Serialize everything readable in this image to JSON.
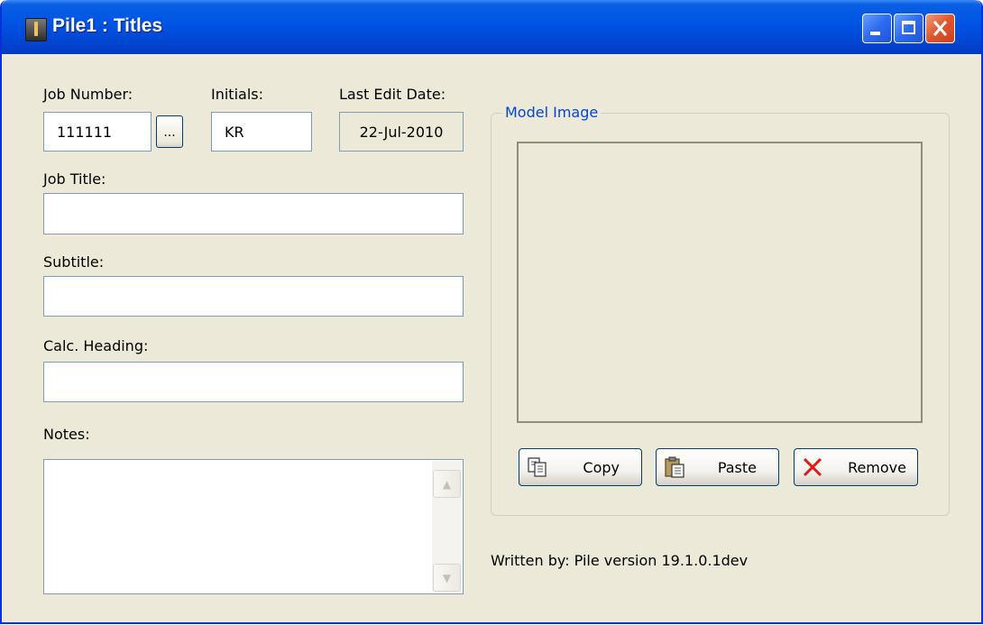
{
  "window": {
    "title": "Pile1 : Titles"
  },
  "form": {
    "job_number_label": "Job Number:",
    "job_number_value": "111111",
    "browse_label": "...",
    "initials_label": "Initials:",
    "initials_value": "KR",
    "last_edit_label": "Last Edit Date:",
    "last_edit_value": "22-Jul-2010",
    "job_title_label": "Job Title:",
    "job_title_value": "",
    "subtitle_label": "Subtitle:",
    "subtitle_value": "",
    "calc_heading_label": "Calc. Heading:",
    "calc_heading_value": "",
    "notes_label": "Notes:",
    "notes_value": ""
  },
  "model_image": {
    "group_label": "Model Image",
    "buttons": {
      "copy": "Copy",
      "paste": "Paste",
      "remove": "Remove"
    }
  },
  "footer": {
    "written_by": "Written by: Pile version 19.1.0.1dev"
  },
  "icons": {
    "app": "pile-app-icon",
    "copy": "copy-icon",
    "paste": "paste-icon",
    "remove": "red-x-icon"
  },
  "colors": {
    "titlebar": "#0055e5",
    "window_bg": "#ece9d8",
    "group_label": "#0046d5",
    "field_border": "#7f9db9"
  }
}
